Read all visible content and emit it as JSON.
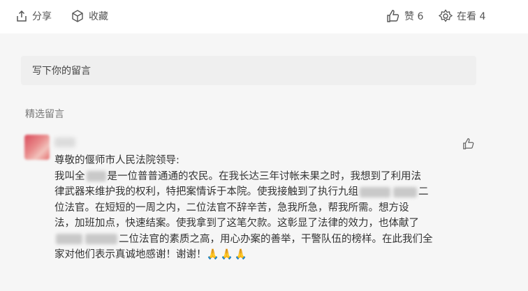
{
  "toolbar": {
    "share_label": "分享",
    "favorite_label": "收藏",
    "like_label": "赞 6",
    "watching_label": "在看 4"
  },
  "comment_input": {
    "placeholder": "写下你的留言"
  },
  "featured_comments": {
    "title": "精选留言",
    "items": [
      {
        "lines": {
          "l1": "尊敬的偃师市人民法院领导:",
          "l2a": "我叫全",
          "l2b": "是一位普普通通的农民。在我长达三年讨帐未果之时，我想到了利用法",
          "l3a": "律武器来维护我的权利，特把案情诉于本院。使我接触到了执行九组",
          "l3b": "二",
          "l4": "位法官。在短短的一周之内，二位法官不辞辛苦，急我所急，帮我所需。想方设",
          "l5": "法，加班加点，快速结案。使我拿到了这笔欠款。这彰显了法律的效力，也体献了",
          "l6": "二位法官的素质之高，用心办案的善举，干警队伍的榜样。在此我们全",
          "l7": "家对他们表示真诚地感谢！谢谢！",
          "emoji": "🙏🙏🙏"
        }
      }
    ]
  }
}
